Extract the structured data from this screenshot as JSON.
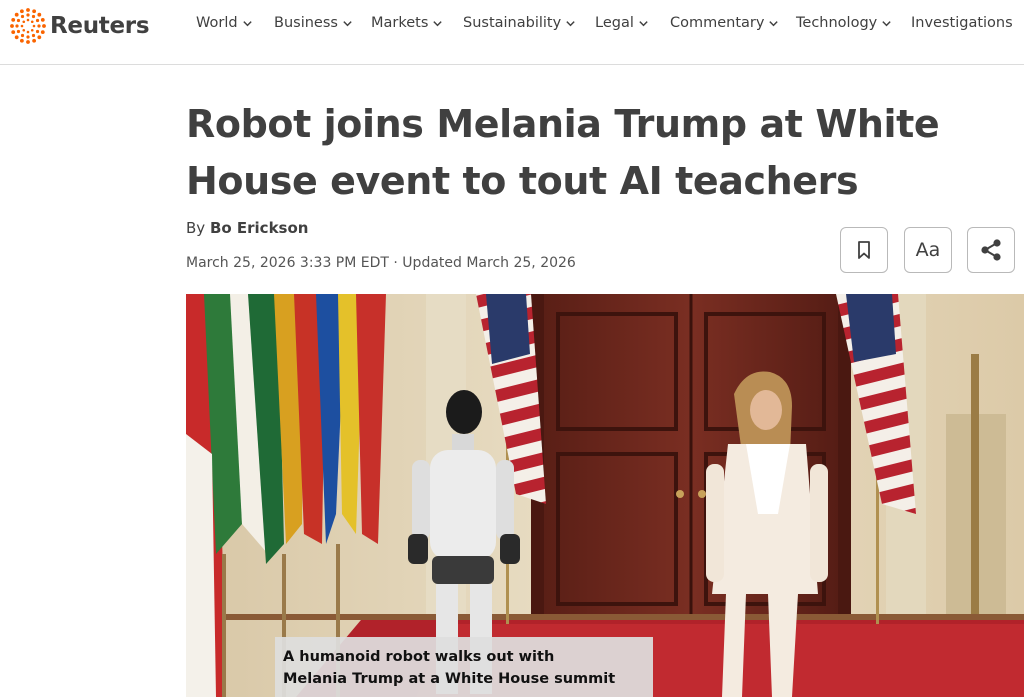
{
  "header": {
    "logo_text": "Reuters",
    "logo_icon": "reuters-dot-ring-icon",
    "nav": [
      {
        "label": "World",
        "has_menu": true
      },
      {
        "label": "Business",
        "has_menu": true
      },
      {
        "label": "Markets",
        "has_menu": true
      },
      {
        "label": "Sustainability",
        "has_menu": true
      },
      {
        "label": "Legal",
        "has_menu": true
      },
      {
        "label": "Commentary",
        "has_menu": true
      },
      {
        "label": "Technology",
        "has_menu": true
      },
      {
        "label": "Investigations",
        "has_menu": false
      }
    ]
  },
  "article": {
    "headline": "Robot joins Melania Trump at White House event to tout AI teachers",
    "byline_prefix": "By ",
    "author": "Bo Erickson",
    "dateline": "March 25, 2026 3:33 PM EDT · Updated March 25, 2026",
    "tools": {
      "bookmark_icon": "bookmark-icon",
      "text_size_label": "Aa",
      "share_icon": "share-icon"
    },
    "media": {
      "caption_lines": [
        "A humanoid robot walks out with",
        "Melania Trump at a White House summit"
      ]
    }
  },
  "colors": {
    "logo_orange": "#fa6400",
    "text": "#404040",
    "border": "#dcdcdc"
  }
}
